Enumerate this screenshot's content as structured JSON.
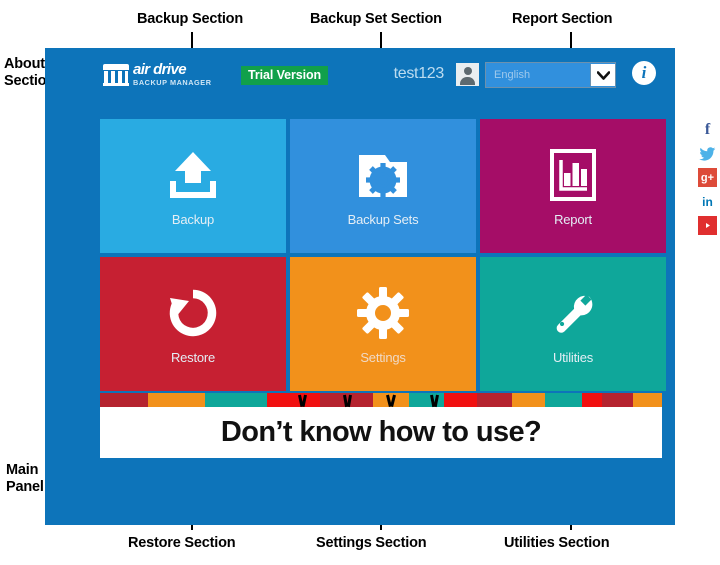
{
  "annotations": {
    "about": "About\nSection",
    "backup": "Backup Section",
    "backup_set": "Backup Set Section",
    "report": "Report Section",
    "restore": "Restore Section",
    "settings": "Settings Section",
    "utilities": "Utilities Section",
    "main_panel": "Main\nPanel"
  },
  "header": {
    "logo_main": "air drive",
    "logo_sub": "BACKUP MANAGER",
    "trial_badge": "Trial Version",
    "username": "test123",
    "avatar_icon": "user-avatar-icon",
    "language_value": "English",
    "language_caret_icon": "chevron-down-icon",
    "info_icon": "info-icon",
    "info_glyph": "i"
  },
  "tiles": [
    {
      "label": "Backup",
      "icon": "upload-arrow-icon",
      "color": "#29abe2",
      "name": "backup"
    },
    {
      "label": "Backup Sets",
      "icon": "folder-gear-icon",
      "color": "#3190dd",
      "name": "backup-sets"
    },
    {
      "label": "Report",
      "icon": "bar-chart-doc-icon",
      "color": "#a50d67",
      "name": "report"
    },
    {
      "label": "Restore",
      "icon": "restore-arrow-icon",
      "color": "#c62032",
      "name": "restore"
    },
    {
      "label": "Settings",
      "icon": "gear-icon",
      "color": "#f2911b",
      "name": "settings"
    },
    {
      "label": "Utilities",
      "icon": "wrench-icon",
      "color": "#0fa79a",
      "name": "utilities"
    }
  ],
  "promo": {
    "text": "Don’t know how to use?",
    "stripe_colors": [
      {
        "color": "#b5232f",
        "w": 52
      },
      {
        "color": "#f2911b",
        "w": 62
      },
      {
        "color": "#0fa79a",
        "w": 68
      },
      {
        "color": "#f11010",
        "w": 58
      },
      {
        "color": "#b5232f",
        "w": 57
      },
      {
        "color": "#f2911b",
        "w": 40
      },
      {
        "color": "#0fa79a",
        "w": 38
      },
      {
        "color": "#f11010",
        "w": 36
      },
      {
        "color": "#b5232f",
        "w": 38
      },
      {
        "color": "#f2911b",
        "w": 36
      },
      {
        "color": "#0fa79a",
        "w": 40
      },
      {
        "color": "#f11010",
        "w": 22
      },
      {
        "color": "#b5232f",
        "w": 33
      },
      {
        "color": "#f2911b",
        "w": 32
      }
    ]
  },
  "social": [
    {
      "name": "facebook",
      "glyph": "f",
      "icon": "facebook-icon"
    },
    {
      "name": "twitter",
      "glyph": "",
      "icon": "twitter-icon"
    },
    {
      "name": "googleplus",
      "glyph": "g+",
      "icon": "google-plus-icon"
    },
    {
      "name": "linkedin",
      "glyph": "in",
      "icon": "linkedin-icon"
    },
    {
      "name": "youtube",
      "glyph": "",
      "icon": "youtube-icon"
    }
  ]
}
